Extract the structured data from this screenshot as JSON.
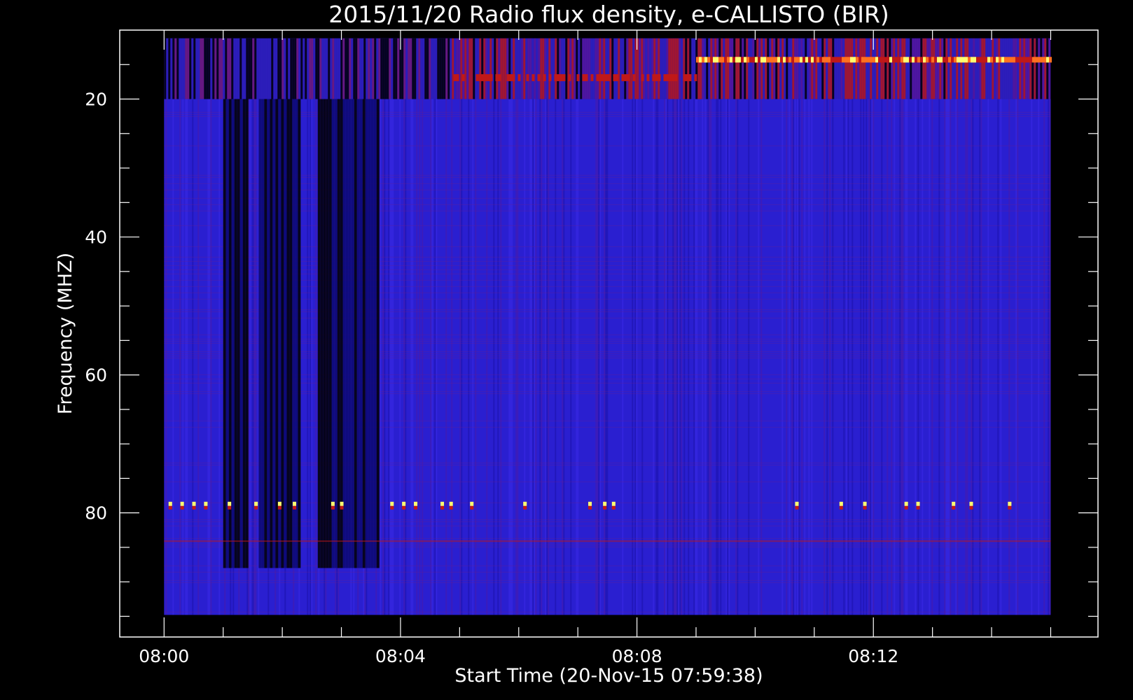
{
  "chart_data": {
    "type": "heatmap",
    "title": "2015/11/20  Radio flux density, e-CALLISTO (BIR)",
    "xlabel": "Start Time (20-Nov-15 07:59:38)",
    "ylabel": "Frequency (MHZ)",
    "x_range_minutes": [
      -0.75,
      15.8
    ],
    "data_x_range_minutes": [
      0.0,
      15.0
    ],
    "y_range": [
      10,
      98
    ],
    "data_y_range": [
      11.2,
      94.8
    ],
    "y_inverted": true,
    "x_ticks": [
      {
        "minute": 0,
        "label": "08:00"
      },
      {
        "minute": 4,
        "label": "08:04"
      },
      {
        "minute": 8,
        "label": "08:08"
      },
      {
        "minute": 12,
        "label": "08:12"
      }
    ],
    "y_ticks": [
      {
        "value": 20,
        "label": "20"
      },
      {
        "value": 40,
        "label": "40"
      },
      {
        "value": 60,
        "label": "60"
      },
      {
        "value": 80,
        "label": "80"
      }
    ],
    "colors": {
      "background": "#000000",
      "axis": "#ffffff",
      "low": "#2a1fd0",
      "mid": "#c01818",
      "high": "#ffff70"
    },
    "features": {
      "top_band": [
        11.2,
        20.0
      ],
      "dark_columns_minutes": [
        [
          1.0,
          1.4
        ],
        [
          1.6,
          2.3
        ],
        [
          2.6,
          3.6
        ]
      ],
      "hot_band_mhz": 14.5,
      "spike_row_mhz": 79.0,
      "spike_minutes": [
        0.1,
        0.3,
        0.5,
        0.7,
        1.1,
        1.55,
        1.95,
        2.2,
        2.85,
        3.0,
        3.85,
        4.05,
        4.25,
        4.7,
        4.85,
        5.2,
        6.1,
        7.2,
        7.45,
        7.6,
        10.7,
        11.45,
        11.85,
        12.55,
        12.75,
        13.35,
        13.65,
        14.3
      ],
      "faint_row_mhz": 84.0
    }
  }
}
